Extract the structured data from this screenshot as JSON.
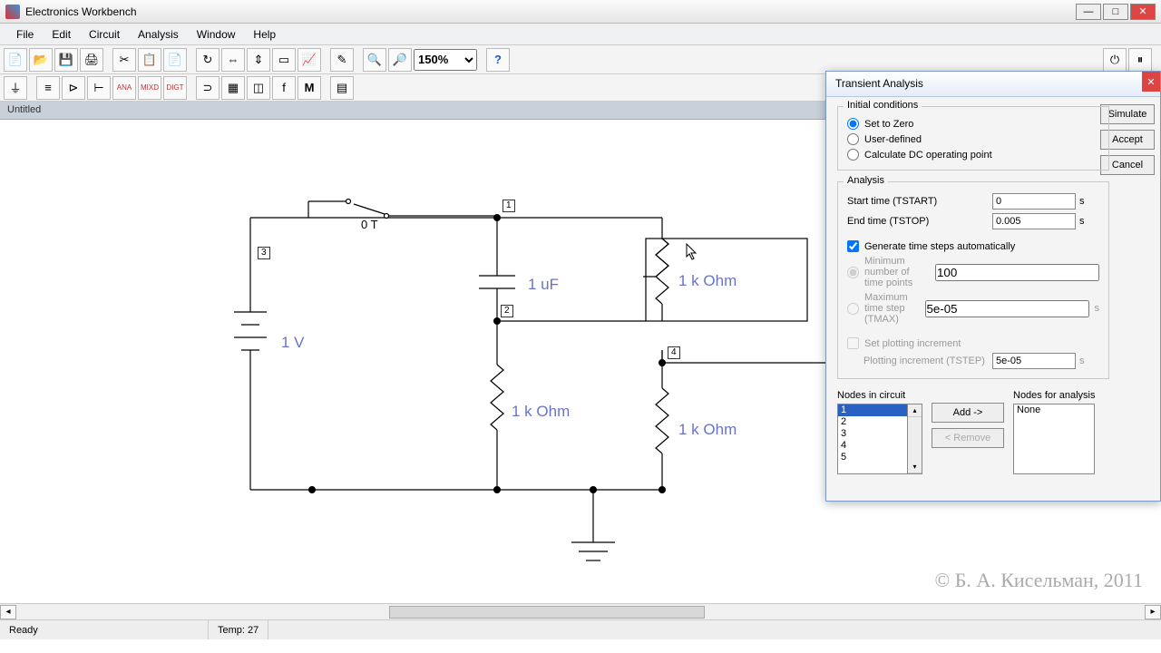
{
  "app": {
    "title": "Electronics Workbench"
  },
  "menu": [
    "File",
    "Edit",
    "Circuit",
    "Analysis",
    "Window",
    "Help"
  ],
  "zoom": "150%",
  "doc_title": "Untitled",
  "status": {
    "ready": "Ready",
    "temp": "Temp: 27"
  },
  "watermark": "© Б. А. Кисельман, 2011",
  "components": {
    "v_source": "1 V",
    "c1": "1 uF",
    "r1": "1 k Ohm",
    "r2": "1 k Ohm",
    "r3": "1 k Ohm",
    "switch_label": "0 T"
  },
  "nodes": {
    "n1": "1",
    "n2": "2",
    "n3": "3",
    "n4": "4"
  },
  "dialog": {
    "title": "Transient Analysis",
    "buttons": {
      "simulate": "Simulate",
      "accept": "Accept",
      "cancel": "Cancel"
    },
    "initial": {
      "legend": "Initial conditions",
      "zero": "Set to Zero",
      "user": "User-defined",
      "dc": "Calculate DC operating point"
    },
    "analysis": {
      "legend": "Analysis",
      "tstart_label": "Start time (TSTART)",
      "tstart": "0",
      "tstop_label": "End time (TSTOP)",
      "tstop": "0.005",
      "unit": "s",
      "gen_auto": "Generate time steps automatically",
      "min_points_label": "Minimum number of time points",
      "min_points": "100",
      "tmax_label": "Maximum time step (TMAX)",
      "tmax": "5e-05",
      "set_plot": "Set plotting increment",
      "tstep_label": "Plotting increment (TSTEP)",
      "tstep": "5e-05"
    },
    "nodes": {
      "circuit_label": "Nodes in circuit",
      "analysis_label": "Nodes for analysis",
      "circuit": [
        "1",
        "2",
        "3",
        "4",
        "5"
      ],
      "none": "None",
      "add": "Add ->",
      "remove": "< Remove"
    }
  }
}
